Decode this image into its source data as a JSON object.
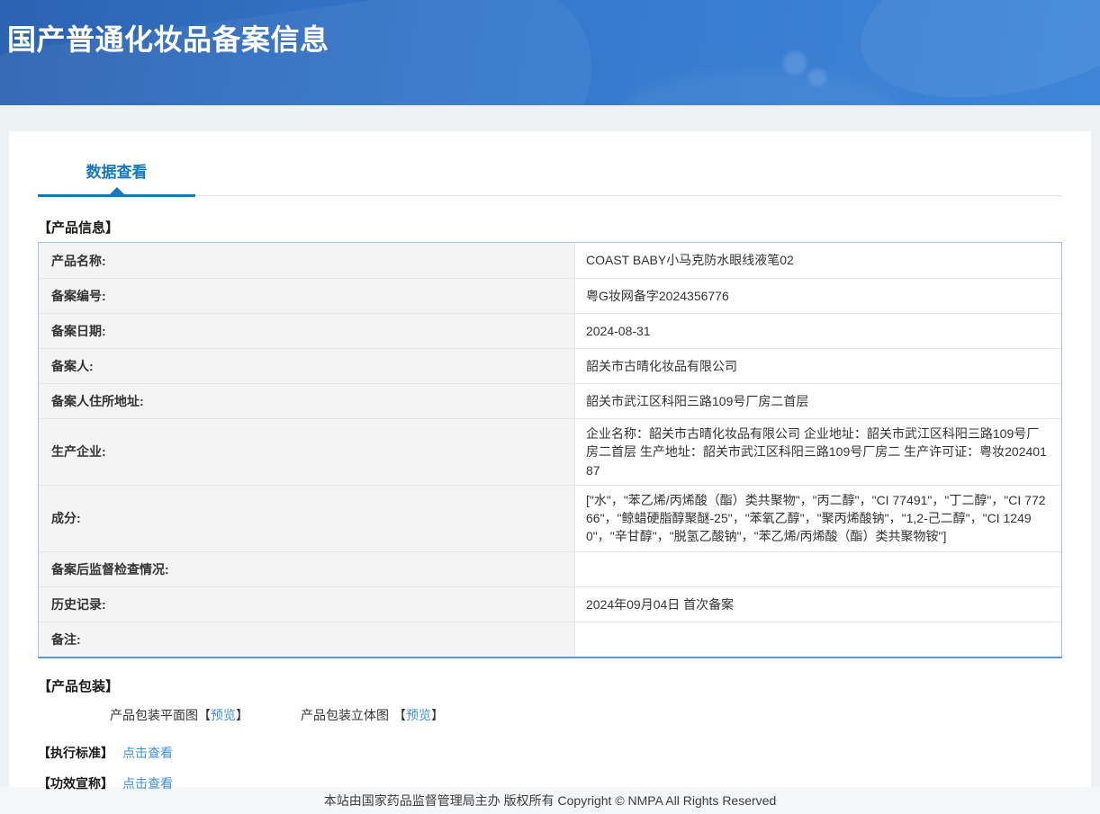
{
  "colors": {
    "header_start": "#2c63b2",
    "header_mid": "#3478cc",
    "header_end": "#3f86d8",
    "tab_blue": "#1678c2",
    "link_blue": "#3e8fdd",
    "table_border": "#a6c1e1",
    "table_border_strong": "#5b9bd5"
  },
  "page": {
    "title": "国产普通化妆品备案信息",
    "footer": "本站由国家药品监督管理局主办 版权所有 Copyright © NMPA All Rights Reserved"
  },
  "tabs": [
    {
      "label": "数据查看",
      "active": true
    }
  ],
  "product_info": {
    "heading": "【产品信息】",
    "rows": [
      {
        "label": "产品名称:",
        "value": "COAST BABY小马克防水眼线液笔02"
      },
      {
        "label": "备案编号:",
        "value": "粤G妆网备字2024356776"
      },
      {
        "label": "备案日期:",
        "value": "2024-08-31"
      },
      {
        "label": "备案人:",
        "value": "韶关市古晴化妆品有限公司"
      },
      {
        "label": "备案人住所地址:",
        "value": "韶关市武江区科阳三路109号厂房二首层"
      },
      {
        "label": "生产企业:",
        "value": "企业名称：韶关市古晴化妆品有限公司 企业地址：韶关市武江区科阳三路109号厂房二首层 生产地址：韶关市武江区科阳三路109号厂房二 生产许可证：粤妆20240187"
      },
      {
        "label": "成分:",
        "value": "[\"水\"，\"苯乙烯/丙烯酸（酯）类共聚物\"，\"丙二醇\"，\"CI 77491\"，\"丁二醇\"，\"CI 77266\"，\"鲸蜡硬脂醇聚醚-25\"，\"苯氧乙醇\"，\"聚丙烯酸钠\"，\"1,2-己二醇\"，\"CI 12490\"，\"辛甘醇\"，\"脱氢乙酸钠\"，\"苯乙烯/丙烯酸（酯）类共聚物铵\"]"
      },
      {
        "label": "备案后监督检查情况:",
        "value": ""
      },
      {
        "label": "历史记录:",
        "value": "2024年09月04日 首次备案"
      },
      {
        "label": "备注:",
        "value": ""
      }
    ]
  },
  "packaging": {
    "heading": "【产品包装】",
    "items": [
      {
        "label": "产品包装平面图",
        "bracket_open": "【",
        "link": "预览",
        "bracket_close": "】"
      },
      {
        "label": "产品包装立体图",
        "bracket_open": "【",
        "link": "预览",
        "bracket_close": "】"
      }
    ]
  },
  "extra_links": [
    {
      "heading": "【执行标准】",
      "link": "点击查看"
    },
    {
      "heading": "【功效宣称】",
      "link": "点击查看"
    }
  ]
}
